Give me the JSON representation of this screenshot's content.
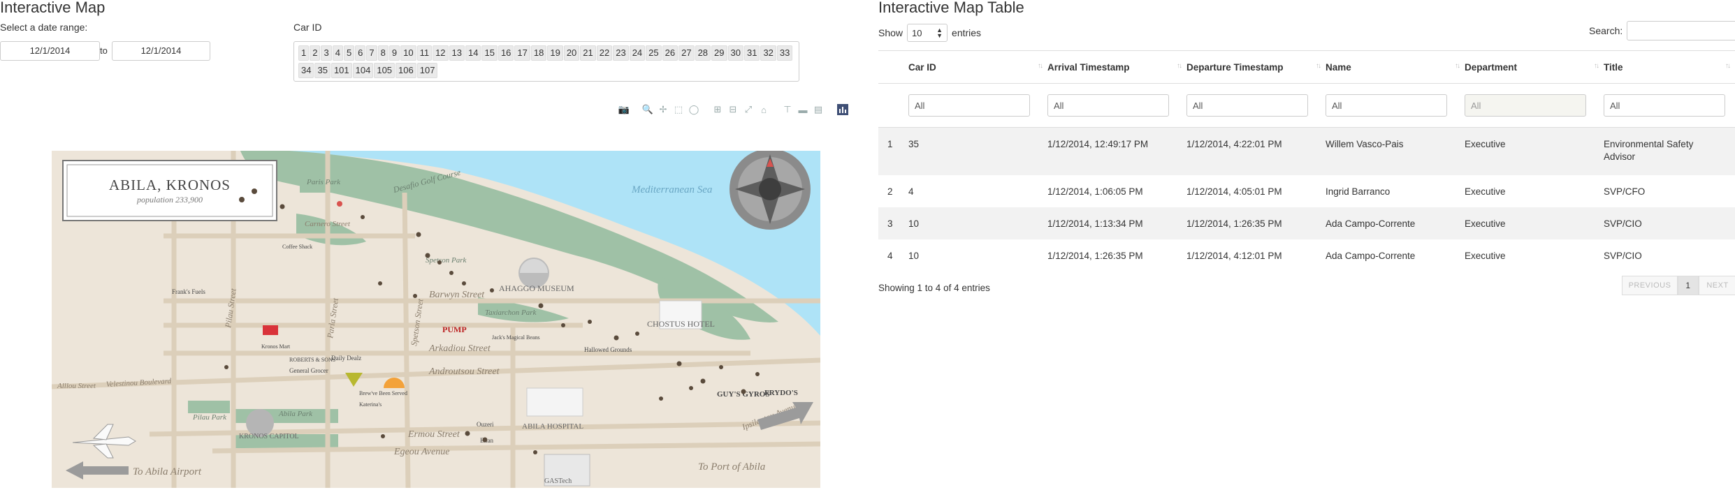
{
  "left": {
    "title": "Interactive Map",
    "date_label": "Select a date range:",
    "date_start": "12/1/2014",
    "date_sep": "to",
    "date_end": "12/1/2014",
    "car_label": "Car ID",
    "car_ids": [
      "1",
      "2",
      "3",
      "4",
      "5",
      "6",
      "7",
      "8",
      "9",
      "10",
      "11",
      "12",
      "13",
      "14",
      "15",
      "16",
      "17",
      "18",
      "19",
      "20",
      "21",
      "22",
      "23",
      "24",
      "25",
      "26",
      "27",
      "28",
      "29",
      "30",
      "31",
      "32",
      "33",
      "34",
      "35",
      "101",
      "104",
      "105",
      "106",
      "107"
    ]
  },
  "modebar": {
    "icons": [
      "camera-icon",
      "zoom-icon",
      "pan-icon",
      "box-select-icon",
      "lasso-select-icon",
      "zoom-in-icon",
      "zoom-out-icon",
      "autoscale-icon",
      "reset-axes-icon",
      "spike-lines-icon",
      "hover-closest-icon",
      "hover-compare-icon",
      "plotly-logo-icon"
    ]
  },
  "map": {
    "title": "ABILA, KRONOS",
    "population": "population 233,900",
    "sea": "Mediterranean Sea",
    "labels": {
      "paris_park": "Paris Park",
      "carnero_street": "Carnero Street",
      "spetson_park": "Spetson Park",
      "barwyn_street": "Barwyn Street",
      "ahaggo_museum": "AHAGGO MUSEUM",
      "taxiarchon_park": "Taxiarchon Park",
      "chostus_hotel": "CHOSTUS HOTEL",
      "arkadiou_street": "Arkadiou Street",
      "androutsou_street": "Androutsou Street",
      "velestinou_blvd": "Velestinou Boulevard",
      "alllou_street": "Alllou Street",
      "pilau_street": "Pilau Street",
      "parla_street": "Parla Street",
      "spetson_street": "Spetson Street",
      "ermou_street": "Ermou Street",
      "egeou_avenue": "Egeou Avenue",
      "abila_park": "Abila Park",
      "pilau_park": "Pilau Park",
      "kronos_capitol": "KRONOS CAPITOL",
      "abila_hospital": "ABILA HOSPITAL",
      "to_airport": "To Abila Airport",
      "to_port": "To Port of Abila",
      "ipsilantou_ave": "Ipsilantou Avenue",
      "guys_gyros": "GUY'S GYROS",
      "frydos": "FRYDO'S",
      "franks_fuels": "Frank's Fuels",
      "pump": "PUMP",
      "daily_dealz": "Daily Dealz",
      "gastech": "GASTech",
      "hallowed_grounds": "Hallowed Grounds",
      "ouzeri": "Ouzeri",
      "elian": "Elian",
      "katerinas": "Katerina's",
      "brew_ve": "Brew've Been Served",
      "general_grocer": "General Grocer",
      "roberts_sons": "ROBERTS & SONS",
      "kronos_mart": "Kronos Mart",
      "desafio_golf": "Desafio Golf Course",
      "jacks_magical": "Jack's Magical Beans",
      "coffee_shack": "Coffee Shack"
    }
  },
  "right": {
    "title": "Interactive Map Table",
    "show_label": "Show",
    "entries_value": "10",
    "entries_label": "entries",
    "search_label": "Search:",
    "columns": [
      "Car ID",
      "Arrival Timestamp",
      "Departure Timestamp",
      "Name",
      "Department",
      "Title"
    ],
    "filter_placeholder": "All",
    "rows": [
      {
        "idx": "1",
        "car_id": "35",
        "arrival": "1/12/2014, 12:49:17 PM",
        "departure": "1/12/2014, 4:22:01 PM",
        "name": "Willem Vasco-Pais",
        "department": "Executive",
        "title_l1": "Environmental Safety",
        "title_l2": "Advisor"
      },
      {
        "idx": "2",
        "car_id": "4",
        "arrival": "1/12/2014, 1:06:05 PM",
        "departure": "1/12/2014, 4:05:01 PM",
        "name": "Ingrid Barranco",
        "department": "Executive",
        "title_l1": "SVP/CFO",
        "title_l2": ""
      },
      {
        "idx": "3",
        "car_id": "10",
        "arrival": "1/12/2014, 1:13:34 PM",
        "departure": "1/12/2014, 1:26:35 PM",
        "name": "Ada Campo-Corrente",
        "department": "Executive",
        "title_l1": "SVP/CIO",
        "title_l2": ""
      },
      {
        "idx": "4",
        "car_id": "10",
        "arrival": "1/12/2014, 1:26:35 PM",
        "departure": "1/12/2014, 4:12:01 PM",
        "name": "Ada Campo-Corrente",
        "department": "Executive",
        "title_l1": "SVP/CIO",
        "title_l2": ""
      }
    ],
    "showing_text": "Showing 1 to 4 of 4 entries",
    "pager": {
      "previous": "PREVIOUS",
      "page": "1",
      "next": "NEXT"
    }
  }
}
